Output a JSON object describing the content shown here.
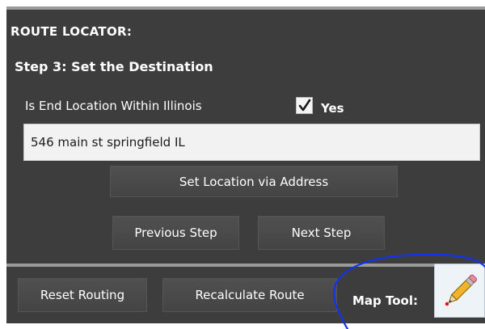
{
  "panel": {
    "title": "ROUTE LOCATOR:",
    "step_title": "Step 3:  Set the Destination",
    "question": "Is End Location Within Illinois",
    "checkbox_checked": true,
    "checkbox_label": "Yes",
    "address_value": "546 main st springfield IL",
    "buttons": {
      "set_location": "Set Location via Address",
      "previous": "Previous Step",
      "next": "Next Step",
      "reset": "Reset Routing",
      "recalculate": "Recalculate Route"
    },
    "map_tool_label": "Map Tool:",
    "map_tool_icon": "pencil-icon"
  },
  "colors": {
    "panel_bg": "#3d3d3d",
    "divider": "#9b9b9b",
    "button_bg": "#4a4a4a",
    "annotation_stroke": "#1133ee"
  }
}
